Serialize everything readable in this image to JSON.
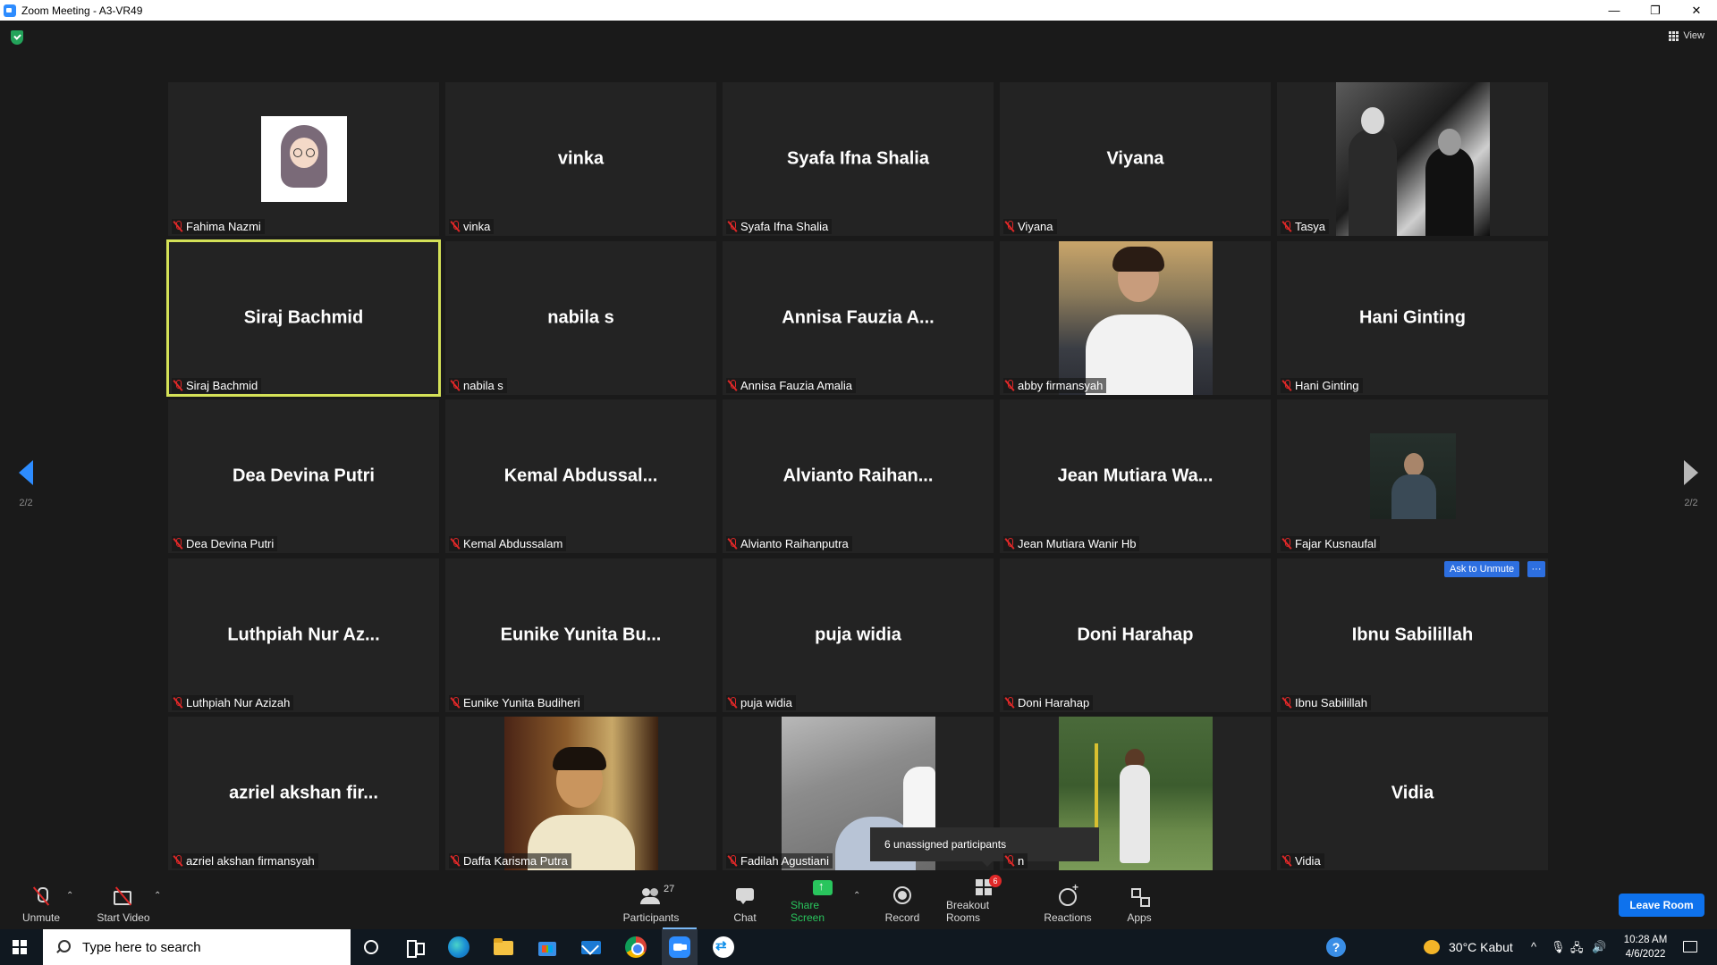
{
  "window": {
    "title": "Zoom Meeting - A3-VR49",
    "minimize": "—",
    "restore": "❐",
    "close": "✕"
  },
  "view_label": "View",
  "page_nav": {
    "left": "2/2",
    "right": "2/2"
  },
  "tiles": [
    {
      "display": "",
      "label": "Fahima Nazmi",
      "video": "avatar"
    },
    {
      "display": "vinka",
      "label": "vinka"
    },
    {
      "display": "Syafa Ifna Shalia",
      "label": "Syafa Ifna Shalia"
    },
    {
      "display": "Viyana",
      "label": "Viyana"
    },
    {
      "display": "",
      "label": "Tasya",
      "video": "dark-group"
    },
    {
      "display": "Siraj Bachmid",
      "label": "Siraj Bachmid",
      "active_speaker": true
    },
    {
      "display": "nabila s",
      "label": "nabila s"
    },
    {
      "display": "Annisa Fauzia A...",
      "label": "Annisa Fauzia Amalia"
    },
    {
      "display": "",
      "label": "abby firmansyah",
      "video": "person"
    },
    {
      "display": "Hani Ginting",
      "label": "Hani Ginting"
    },
    {
      "display": "Dea Devina Putri",
      "label": "Dea Devina Putri"
    },
    {
      "display": "Kemal Abdussal...",
      "label": "Kemal Abdussalam"
    },
    {
      "display": "Alvianto Raihan...",
      "label": "Alvianto Raihanputra"
    },
    {
      "display": "Jean Mutiara Wa...",
      "label": "Jean Mutiara Wanir Hb"
    },
    {
      "display": "",
      "label": "Fajar Kusnaufal",
      "video": "small-person"
    },
    {
      "display": "Luthpiah Nur Az...",
      "label": "Luthpiah Nur Azizah"
    },
    {
      "display": "Eunike Yunita Bu...",
      "label": "Eunike Yunita Budiheri"
    },
    {
      "display": "puja widia",
      "label": "puja widia"
    },
    {
      "display": "Doni Harahap",
      "label": "Doni Harahap"
    },
    {
      "display": "Ibnu Sabilillah",
      "label": "Ibnu Sabilillah"
    },
    {
      "display": "azriel akshan fir...",
      "label": "azriel akshan firmansyah"
    },
    {
      "display": "",
      "label": "Daffa Karisma Putra",
      "video": "person"
    },
    {
      "display": "",
      "label": "Fadilah Agustiani",
      "video": "object"
    },
    {
      "display": "",
      "label": "n",
      "video": "outdoor"
    },
    {
      "display": "Vidia",
      "label": "Vidia"
    }
  ],
  "ask_unmute": {
    "label": "Ask to Unmute",
    "more": "···"
  },
  "tooltip": "6 unassigned participants",
  "toolbar": {
    "unmute": "Unmute",
    "start_video": "Start Video",
    "participants": "Participants",
    "participants_count": "27",
    "chat": "Chat",
    "share_screen": "Share Screen",
    "record": "Record",
    "breakout_rooms": "Breakout Rooms",
    "breakout_badge": "6",
    "reactions": "Reactions",
    "apps": "Apps",
    "leave": "Leave Room",
    "caret": "⌃"
  },
  "taskbar": {
    "search_placeholder": "Type here to search",
    "help": "?",
    "weather": "30°C  Kabut",
    "tray_chevron": "^",
    "tray_mic": "🎙",
    "tray_network": "🖧",
    "tray_volume": "🔊",
    "time": "10:28 AM",
    "date": "4/6/2022"
  },
  "colors": {
    "accent": "#2d8cff",
    "active_speaker": "#d4e157",
    "share_green": "#29c55d",
    "muted_red": "#e02828",
    "leave_blue": "#0e72ed"
  }
}
